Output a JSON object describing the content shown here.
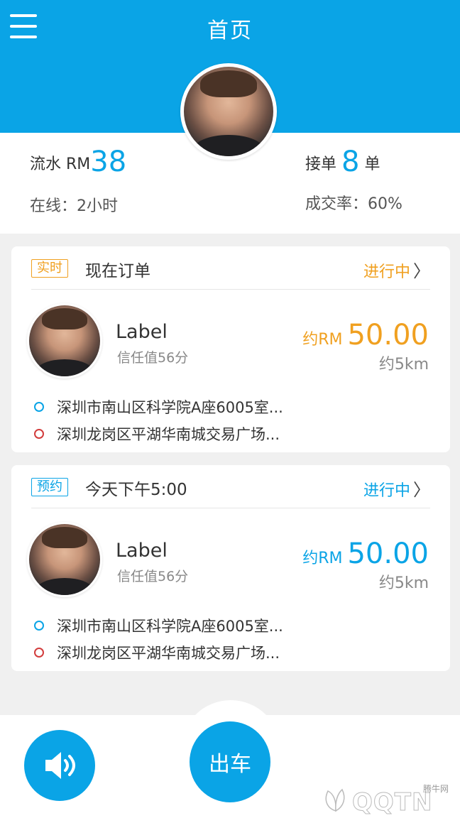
{
  "header": {
    "title": "首页"
  },
  "stats": {
    "revenue_label": "流水 RM",
    "revenue_value": "38",
    "orders_label": "接单 ",
    "orders_value": "8",
    "orders_unit": " 单",
    "online_text": "在线：2小时",
    "rate_text": "成交率：60%"
  },
  "orders": [
    {
      "tag": "实时",
      "title": "现在订单",
      "status": "进行中",
      "name": "Label",
      "trust": "信任值56分",
      "price_prefix": "约RM ",
      "price": "50.00",
      "distance": "约5km",
      "from": "深圳市南山区科学院A座6005室...",
      "to": "深圳龙岗区平湖华南城交易广场...",
      "accent": "#f0a020"
    },
    {
      "tag": "预约",
      "title": "今天下午5:00",
      "status": "进行中",
      "name": "Label",
      "trust": "信任值56分",
      "price_prefix": "约RM ",
      "price": "50.00",
      "distance": "约5km",
      "from": "深圳市南山区科学院A座6005室...",
      "to": "深圳龙岗区平湖华南城交易广场...",
      "accent": "#0aa4e6"
    }
  ],
  "bottom": {
    "go_label": "出车",
    "sound_icon": "speaker-icon"
  },
  "watermark": {
    "text": "QQTN",
    "small": "腾牛网"
  },
  "colors": {
    "primary": "#0aa4e6",
    "orange": "#f0a020",
    "start_dot": "#0aa4e6",
    "end_dot": "#d23c3c"
  }
}
